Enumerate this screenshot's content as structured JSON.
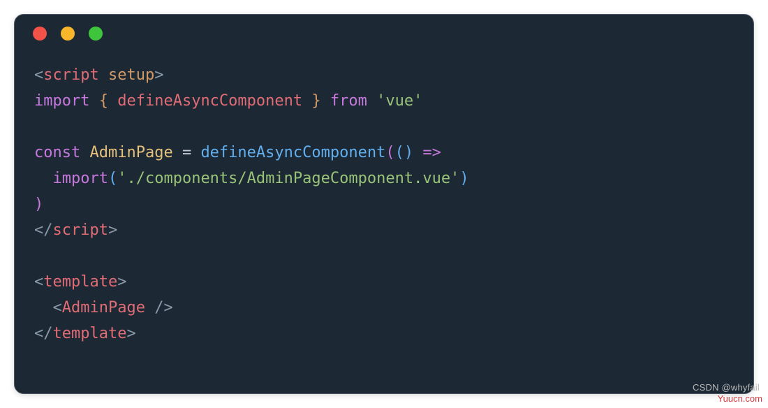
{
  "code": {
    "line1": {
      "open": "<",
      "tag": "script",
      "space": " ",
      "attr": "setup",
      "close": ">"
    },
    "line2": {
      "import": "import",
      "lbrace": " { ",
      "ident": "defineAsyncComponent",
      "rbrace": " } ",
      "from": "from",
      "str": " 'vue'"
    },
    "line3": "",
    "line4": {
      "const": "const",
      "var": " AdminPage ",
      "eq": "= ",
      "func": "defineAsyncComponent",
      "lp": "(",
      "lp2": "(",
      "rp2": ")",
      "arrow": " =>"
    },
    "line5": {
      "indent": "  ",
      "import": "import",
      "lp": "(",
      "str": "'./components/AdminPageComponent.vue'",
      "rp": ")"
    },
    "line6": {
      "rp": ")"
    },
    "line7": {
      "open": "</",
      "tag": "script",
      "close": ">"
    },
    "line8": "",
    "line9": {
      "open": "<",
      "tag": "template",
      "close": ">"
    },
    "line10": {
      "indent": "  ",
      "open": "<",
      "tag": "AdminPage",
      "close": " />"
    },
    "line11": {
      "open": "</",
      "tag": "template",
      "close": ">"
    }
  },
  "watermark": "CSDN @whyfail",
  "brand": "Yuucn.com"
}
